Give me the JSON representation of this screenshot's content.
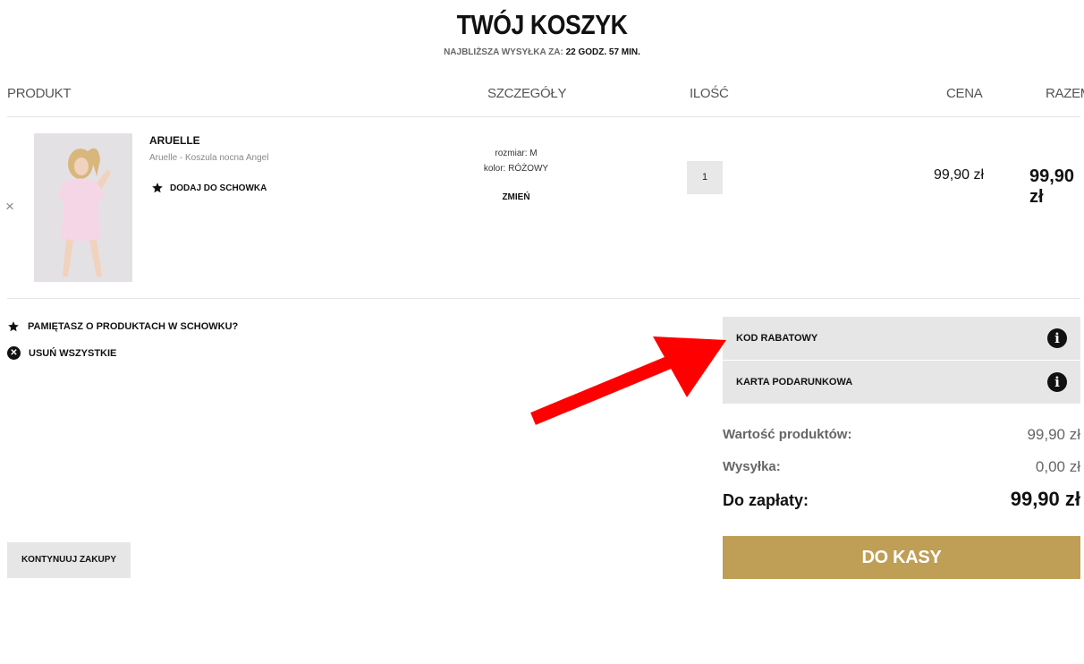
{
  "header": {
    "title": "TWÓJ KOSZYK",
    "shipping_prefix": "NAJBLIŻSZA WYSYŁKA ZA:",
    "shipping_time": "22 GODZ. 57 MIN."
  },
  "columns": {
    "product": "PRODUKT",
    "details": "SZCZEGÓŁY",
    "quantity": "ILOŚĆ",
    "price": "CENA",
    "total": "RAZEM"
  },
  "item": {
    "brand": "ARUELLE",
    "name": "Aruelle - Koszula nocna Angel",
    "add_to_wishlist": "DODAJ DO SCHOWKA",
    "size": "rozmiar: M",
    "color": "kolor: RÓŻOWY",
    "change": "ZMIEŃ",
    "quantity": "1",
    "price": "99,90 zł",
    "total": "99,90 zł",
    "remove_icon": "×"
  },
  "actions": {
    "wishlist_reminder": "PAMIĘTASZ O PRODUKTACH W SCHOWKU?",
    "remove_all": "USUŃ WSZYSTKIE",
    "continue_shopping": "KONTYNUUJ ZAKUPY"
  },
  "accordion": {
    "discount_code": "KOD RABATOWY",
    "gift_card": "KARTA PODARUNKOWA",
    "info_icon": "i"
  },
  "summary": {
    "products_label": "Wartość produktów:",
    "products_value": "99,90 zł",
    "shipping_label": "Wysyłka:",
    "shipping_value": "0,00 zł",
    "to_pay_label": "Do zapłaty:",
    "to_pay_value": "99,90 zł",
    "checkout": "DO KASY"
  },
  "colors": {
    "accent": "#bf9e55",
    "annotation_arrow": "#ff0000"
  }
}
